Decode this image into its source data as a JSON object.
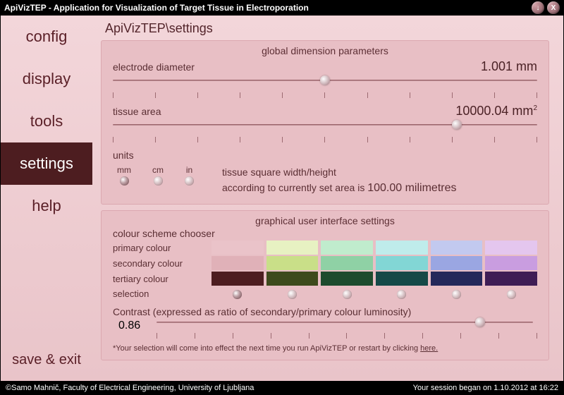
{
  "window": {
    "title": "ApiVizTEP - Application for Visualization of Target Tissue in Electroporation",
    "min_label": "↓",
    "close_label": "X"
  },
  "sidebar": {
    "items": [
      {
        "label": "config"
      },
      {
        "label": "display"
      },
      {
        "label": "tools"
      },
      {
        "label": "settings"
      },
      {
        "label": "help"
      }
    ],
    "save_exit": "save & exit"
  },
  "breadcrumb": "ApiVizTEP\\settings",
  "gdp": {
    "title": "global dimension parameters",
    "electrode_label": "electrode diameter",
    "electrode_value": "1.001 mm",
    "tissue_label": "tissue area",
    "tissue_value_num": "10000.04 mm",
    "tissue_value_sup": "2",
    "units_label": "units",
    "unit_mm": "mm",
    "unit_cm": "cm",
    "unit_in": "in",
    "unit_desc_l1": "tissue square width/height",
    "unit_desc_l2_a": "according to currently set area is ",
    "unit_desc_l2_b": "100.00 milimetres"
  },
  "gui": {
    "title": "graphical user interface settings",
    "chooser_label": "colour scheme chooser",
    "primary_label": "primary colour",
    "secondary_label": "secondary colour",
    "tertiary_label": "tertiary colour",
    "selection_label": "selection",
    "swatches": {
      "primary": [
        "#eac3c9",
        "#e7f1c2",
        "#c0eccd",
        "#bfeceb",
        "#c2c9ef",
        "#e4c6ee"
      ],
      "secondary": [
        "#e0b1b8",
        "#c9df88",
        "#8fd1a5",
        "#82d6d5",
        "#9aa6e2",
        "#c99de0"
      ],
      "tertiary": [
        "#4d1d20",
        "#3d4a1c",
        "#1d4b2e",
        "#154948",
        "#24285a",
        "#3f1d55"
      ]
    },
    "contrast_label": "Contrast (expressed as ratio of secondary/primary colour luminosity)",
    "contrast_value": "0.86",
    "note_a": "*Your selection will come into effect the next time you run ApiVizTEP or restart by clicking ",
    "note_link": "here."
  },
  "status": {
    "left": "©Samo Mahnič, Faculty of Electrical Engineering, University of Ljubljana",
    "right": "Your session began on 1.10.2012 at 16:22"
  }
}
